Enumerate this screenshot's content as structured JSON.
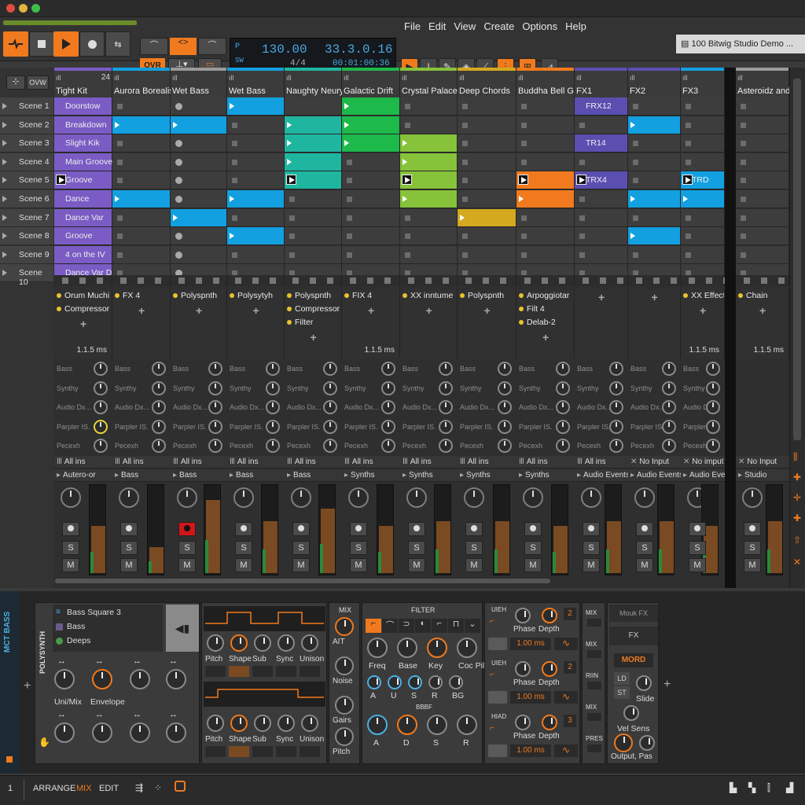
{
  "window": {
    "project_tab": "100 Bitwig Studio Demo ..."
  },
  "menu": [
    "File",
    "Edit",
    "View",
    "Create",
    "Options",
    "Help"
  ],
  "transport": {
    "tempo": "130.00",
    "position": "33.3.0.16",
    "time_sig": "4/4",
    "time": "00:01:00:36",
    "ovr_label": "OVR",
    "tempo_tap": "P",
    "sw": "SW"
  },
  "launcher_header": {
    "ovw": "OVW",
    "count": "24"
  },
  "colors": {
    "orange": "#f07a1d",
    "purple": "#7a5cc4",
    "blue": "#12a0e0",
    "teal": "#1fb6a0",
    "green": "#1db94a",
    "lime": "#86c23a",
    "yellow": "#d4a81f",
    "indigo": "#5a4fb0"
  },
  "tracks": [
    {
      "name": "Tight Kit",
      "color": "#7a5cc4"
    },
    {
      "name": "Aurora Borealis",
      "color": "#12a0e0"
    },
    {
      "name": "Wet Bass",
      "color": "#9a9a9a"
    },
    {
      "name": "Wet Bass",
      "color": "#12a0e0"
    },
    {
      "name": "Naughty Neury",
      "color": "#1fb6a0"
    },
    {
      "name": "Galactic Drift",
      "color": "#1db94a"
    },
    {
      "name": "Crystal Palace",
      "color": "#86c23a"
    },
    {
      "name": "Deep Chords",
      "color": "#d4a81f"
    },
    {
      "name": "Buddha Bell G",
      "color": "#f07a1d"
    },
    {
      "name": "FX1",
      "color": "#5a4fb0"
    },
    {
      "name": "FX2",
      "color": "#5a4fb0"
    },
    {
      "name": "FX3",
      "color": "#12a0e0"
    },
    {
      "name": "Asteroidz and...",
      "color": "#9a9a9a"
    }
  ],
  "scenes": [
    "Scene 1",
    "Scene 2",
    "Scene 3",
    "Scene 4",
    "Scene 5",
    "Scene 6",
    "Scene 7",
    "Scene 8",
    "Scene 9",
    "Scene 10"
  ],
  "clips": [
    [
      "Doorstow",
      "Breakdown",
      "Slight Kik",
      "Main Groove",
      "Groove",
      "Dance",
      "Dance Var",
      "Groove",
      "4 on the IV",
      "Dance Var Drop"
    ],
    [],
    [],
    [],
    [],
    [],
    [],
    [],
    [],
    [
      "FRX12",
      "",
      "TR14",
      "",
      "TRX4",
      "",
      "",
      "",
      ""
    ],
    [],
    [
      "",
      "",
      "",
      "",
      "TRD",
      "",
      "",
      "",
      ""
    ],
    []
  ],
  "devices": [
    [
      "Orum Muchi",
      "Compressor"
    ],
    [
      "FX 4"
    ],
    [
      "Polyspnth"
    ],
    [
      "Polysytyh"
    ],
    [
      "Polyspnth",
      "Compressor",
      "Filter"
    ],
    [
      "FIX 4"
    ],
    [
      "XX inntume"
    ],
    [
      "Polyspnth"
    ],
    [
      "Arpoggiotar",
      "Filt 4",
      "Delab-2"
    ],
    [],
    [],
    [
      "XX Effect"
    ],
    [
      "Chain"
    ]
  ],
  "latency": "1.1.5 ms",
  "sends": [
    "Bass",
    "Synthy",
    "Audio Dx...",
    "Parpler IS.",
    "Pecexh"
  ],
  "inputs": [
    "All ins",
    "All ins",
    "All ins",
    "All ins",
    "All ins",
    "All ins",
    "All ins",
    "All ins",
    "All ins",
    "All ins",
    "No Input",
    "No imput",
    "No Input"
  ],
  "outputs": [
    "Autero-or",
    "Bass",
    "Bass",
    "Bass",
    "Bass",
    "Synths",
    "Synths",
    "Synths",
    "Synths",
    "Audio Events",
    "Audio Events",
    "Audio Events",
    "Studio"
  ],
  "mixer_labels": {
    "solo": "S",
    "mute": "M"
  },
  "meters": [
    0.55,
    0.3,
    0.85,
    0.6,
    0.75,
    0.55,
    0.6,
    0.6,
    0.55,
    0.6,
    0.6,
    0.55,
    0.6
  ],
  "device_panel": {
    "side_title": "MCT BASS",
    "vertical_label": "POLYSYNTH",
    "browser": [
      "Bass Square 3",
      "Bass",
      "Deeps"
    ],
    "knob_labels_left": [
      "Uni/Mix",
      "Envelope"
    ],
    "osc1_labels": [
      "Pitch",
      "Shape",
      "Sub",
      "Sync",
      "Unison"
    ],
    "osc2_labels": [
      "Pitch",
      "Shape",
      "Sub",
      "Sync",
      "Unison"
    ],
    "mix_title": "MIX",
    "mix_labels": [
      "AIT",
      "Noise",
      "Gairs",
      "Pitch"
    ],
    "filter_title": "FILTER",
    "filter_labels": [
      "Freq",
      "Base",
      "Key",
      "Coc Pill"
    ],
    "filter_small": [
      "A",
      "U",
      "S",
      "R",
      "BG"
    ],
    "env_title": "BBBF",
    "env_labels": [
      "A",
      "D",
      "S",
      "R"
    ],
    "lfo": [
      {
        "title": "UIEH",
        "labels": [
          "Phase",
          "Depth"
        ],
        "num": "2",
        "time": "1.00 ms"
      },
      {
        "title": "UIEH",
        "labels": [
          "Phase",
          "Depth"
        ],
        "num": "2",
        "time": "1.00 ms"
      },
      {
        "title": "HIAD",
        "labels": [
          "Phase",
          "Depth"
        ],
        "num": "3",
        "time": "1.00 ms"
      }
    ],
    "mod_labels": [
      "MIX",
      "MIX",
      "RIIN",
      "MIX",
      "PRES"
    ],
    "right": {
      "mod_fx": "Mouk FX",
      "fx": "FX",
      "mord": "MORD",
      "ld": "LD",
      "st": "ST",
      "slide": "Slide",
      "vel": "Vel Sens",
      "out": "Output, Pas"
    }
  },
  "bottom": {
    "num": "1",
    "arrange": "ARRANGE",
    "mix": "MIX",
    "edit": "EDIT"
  }
}
